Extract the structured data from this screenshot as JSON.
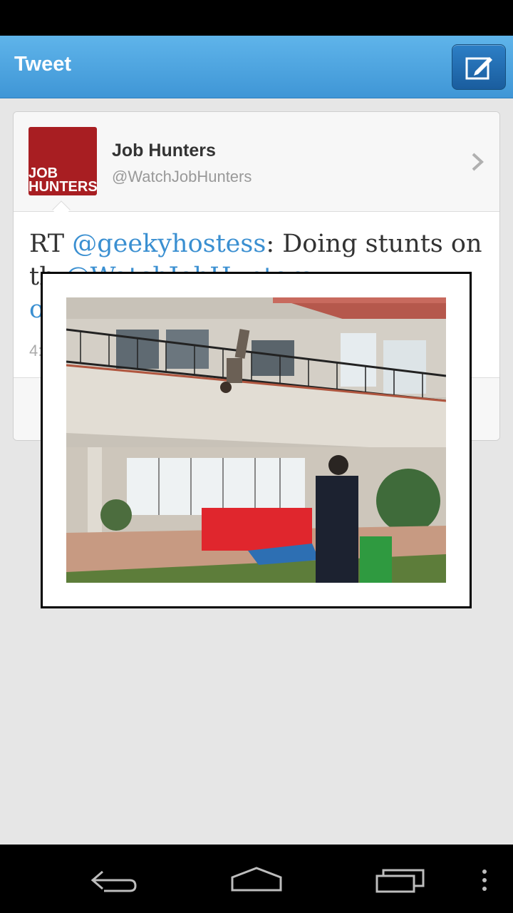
{
  "action_bar": {
    "title": "Tweet",
    "compose_icon": "compose-icon"
  },
  "tweet": {
    "author_name": "Job Hunters",
    "author_handle": "@WatchJobHunters",
    "avatar_text_line1": "JOB",
    "avatar_text_line2": "HUNTERS",
    "text_prefix": "RT ",
    "mention1": "@geekyhostess",
    "text_middle": ": Doing stunts on",
    "text_line2_start": "th",
    "mention2": "@WatchJobHunters",
    "text_line3_start": "o",
    "time_partial": "4:",
    "chevron_icon": "chevron-right-icon"
  },
  "colors": {
    "action_bar": "#4aa3e0",
    "mention": "#3a8fd1",
    "avatar_bg": "#a81e22"
  },
  "nav": {
    "back_icon": "back-icon",
    "home_icon": "home-icon",
    "recents_icon": "recents-icon",
    "menu_icon": "overflow-menu-icon"
  }
}
